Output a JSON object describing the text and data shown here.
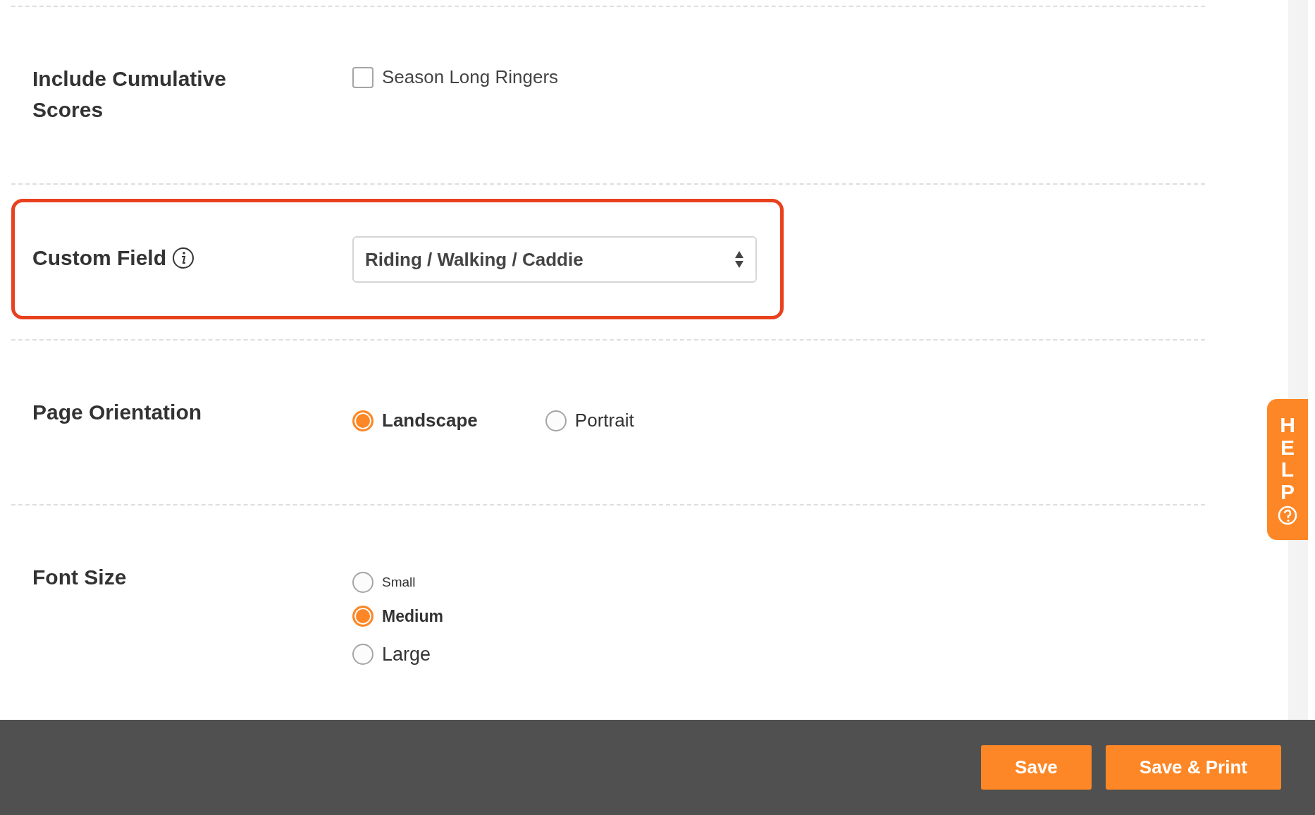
{
  "sections": [
    {
      "kind": "checkbox",
      "label": "Include Cumulative Scores",
      "highlighted": false,
      "options": [
        {
          "label": "Season Long Ringers",
          "checked": false
        }
      ]
    },
    {
      "kind": "select",
      "label": "Custom Field",
      "highlighted": true,
      "value": "Riding / Walking / Caddie"
    },
    {
      "kind": "radio_row",
      "label": "Page Orientation",
      "highlighted": false,
      "options": [
        {
          "label": "Landscape",
          "selected": true
        },
        {
          "label": "Portrait",
          "selected": false
        }
      ]
    },
    {
      "kind": "radio_column",
      "label": "Font Size",
      "highlighted": false,
      "options": [
        {
          "label": "Small",
          "selected": false
        },
        {
          "label": "Medium",
          "selected": true
        },
        {
          "label": "Large",
          "selected": false
        }
      ]
    }
  ],
  "help_tab": {
    "label": "HELP"
  },
  "footer": {
    "buttons": [
      "Save",
      "Save & Print"
    ]
  }
}
